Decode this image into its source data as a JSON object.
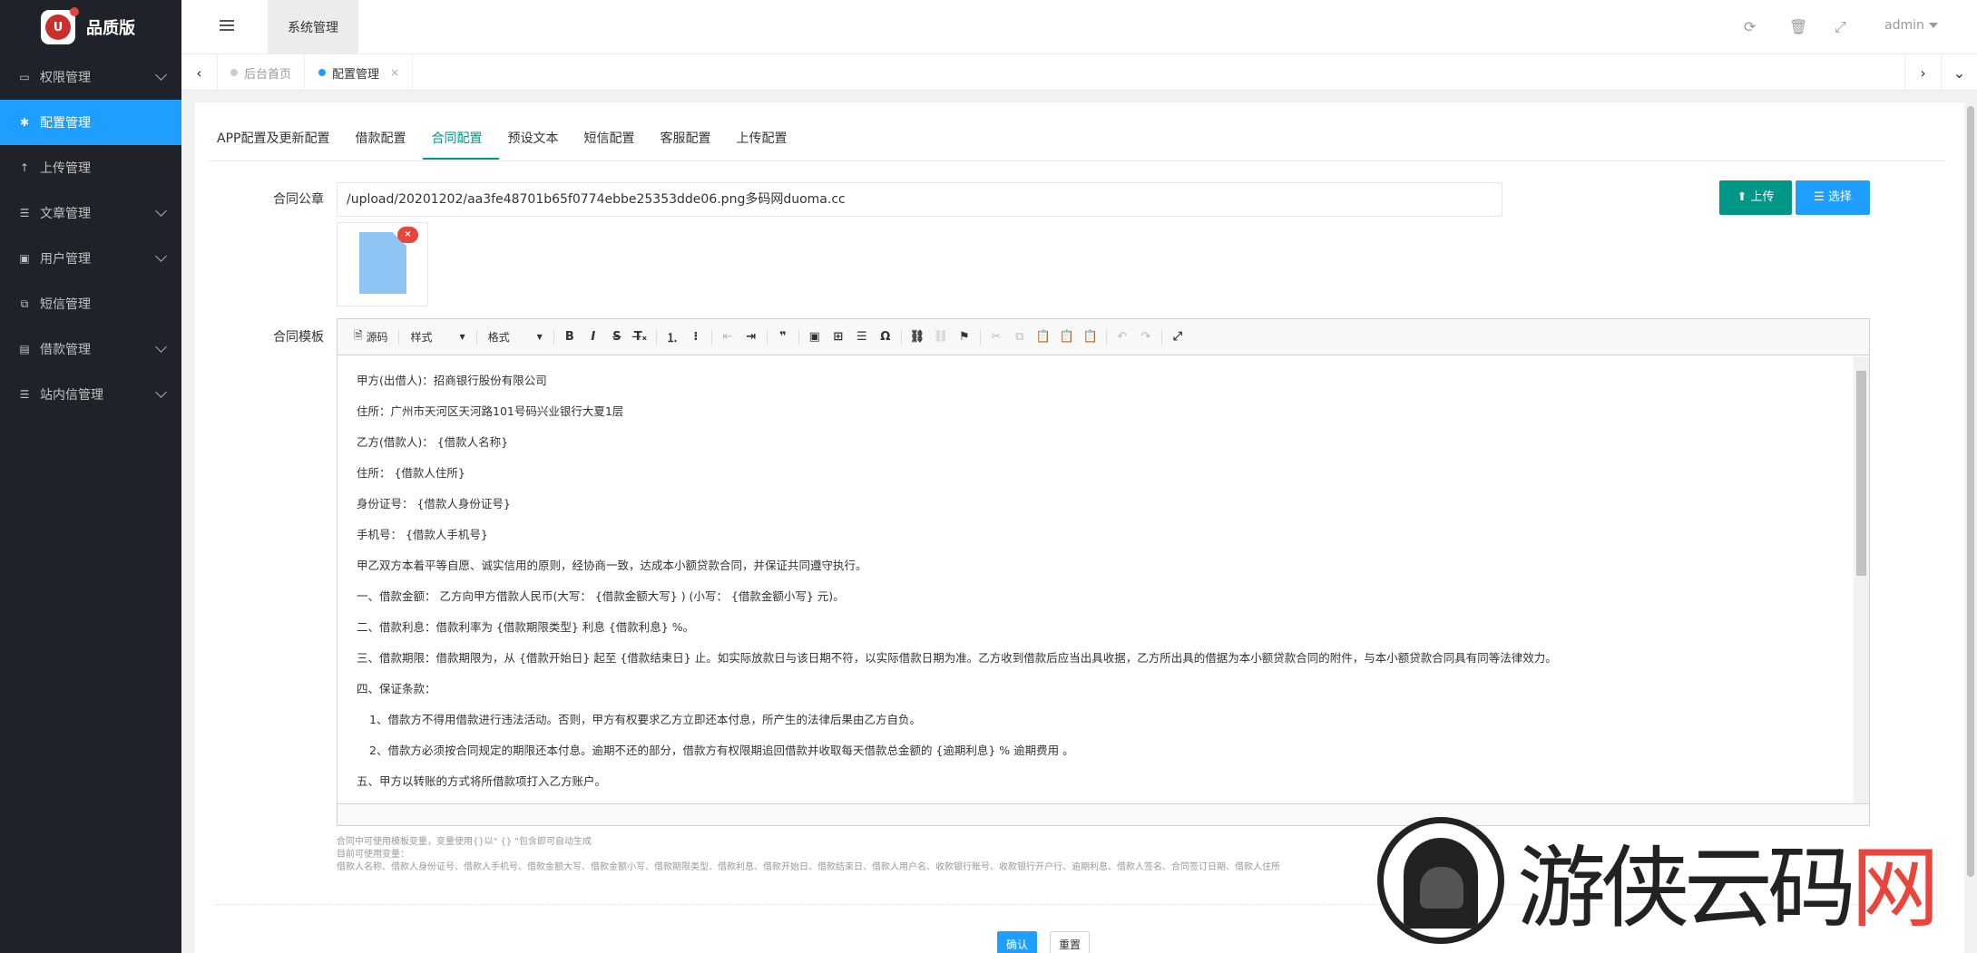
{
  "brand": {
    "name": "品质版",
    "badge_text": "U"
  },
  "sidebar": {
    "items": [
      {
        "label": "权限管理",
        "icon": "laptop-icon",
        "has_arrow": true
      },
      {
        "label": "配置管理",
        "icon": "gear-icon",
        "has_arrow": false,
        "active": true
      },
      {
        "label": "上传管理",
        "icon": "arrow-up-icon",
        "has_arrow": false
      },
      {
        "label": "文章管理",
        "icon": "list-icon",
        "has_arrow": true
      },
      {
        "label": "用户管理",
        "icon": "user-card-icon",
        "has_arrow": true
      },
      {
        "label": "短信管理",
        "icon": "copy-icon",
        "has_arrow": false
      },
      {
        "label": "借款管理",
        "icon": "money-icon",
        "has_arrow": true
      },
      {
        "label": "站内信管理",
        "icon": "list-icon",
        "has_arrow": true
      }
    ]
  },
  "header": {
    "tab": "系统管理",
    "user": "admin"
  },
  "tabsbar": {
    "tabs": [
      {
        "label": "后台首页"
      },
      {
        "label": "配置管理",
        "close": "×"
      }
    ]
  },
  "config_tabs": [
    "APP配置及更新配置",
    "借款配置",
    "合同配置",
    "预设文本",
    "短信配置",
    "客服配置",
    "上传配置"
  ],
  "form": {
    "seal_label": "合同公章",
    "seal_value": "/upload/20201202/aa3fe48701b65f0774ebbe25353dde06.png多码网duoma.cc",
    "upload_btn": "上传",
    "choose_btn": "选择",
    "delete_mark": "×",
    "template_label": "合同模板"
  },
  "toolbar": {
    "source": "源码",
    "style": "样式",
    "format": "格式"
  },
  "contract_lines": [
    "甲方(出借人)：招商银行股份有限公司",
    "住所：广州市天河区天河路101号码兴业银行大夏1层",
    "乙方(借款人)： {借款人名称}",
    "住所： {借款人住所}",
    "身份证号： {借款人身份证号}",
    "手机号： {借款人手机号}",
    "甲乙双方本着平等自愿、诚实信用的原则，经协商一致，达成本小额贷款合同，并保证共同遵守执行。",
    "一、借款金额： 乙方向甲方借款人民币(大写： {借款金额大写} ) (小写： {借款金额小写} 元)。",
    "二、借款利息：借款利率为 {借款期限类型} 利息 {借款利息} %。",
    "三、借款期限：借款期限为，从 {借款开始日} 起至 {借款结束日} 止。如实际放款日与该日期不符，以实际借款日期为准。乙方收到借款后应当出具收据，乙方所出具的借据为本小额贷款合同的附件，与本小额贷款合同具有同等法律效力。",
    "四、保证条款：",
    "1、借款方不得用借款进行违法活动。否则，甲方有权要求乙方立即还本付息，所产生的法律后果由乙方自负。",
    "2、借款方必须按合同规定的期限还本付息。逾期不还的部分，借款方有权限期追回借款并收取每天借款总金额的 {逾期利息} % 逾期费用 。",
    "五、甲方以转账的方式将所借款项打入乙方账户。"
  ],
  "hints": [
    "合同中可使用模板变量，变量使用{}以\" {} \"包含即可自动生成",
    "目前可使用变量：",
    "借款人名称、借款人身份证号、借款人手机号、借款金额大写、借款金额小写、借款期限类型、借款利息、借款开始日、借款结束日、借款人用户名、收款银行账号、收款银行开户行、逾期利息、借款人签名、合同签订日期、借款人住所"
  ],
  "actions": {
    "ok": "确认",
    "reset": "重置"
  },
  "watermark": {
    "text_main": "游侠云码",
    "text_red": "网"
  },
  "colors": {
    "sidebar_bg": "#20222a",
    "active": "#1e9fff",
    "teal": "#009688",
    "danger": "#e8453c"
  }
}
